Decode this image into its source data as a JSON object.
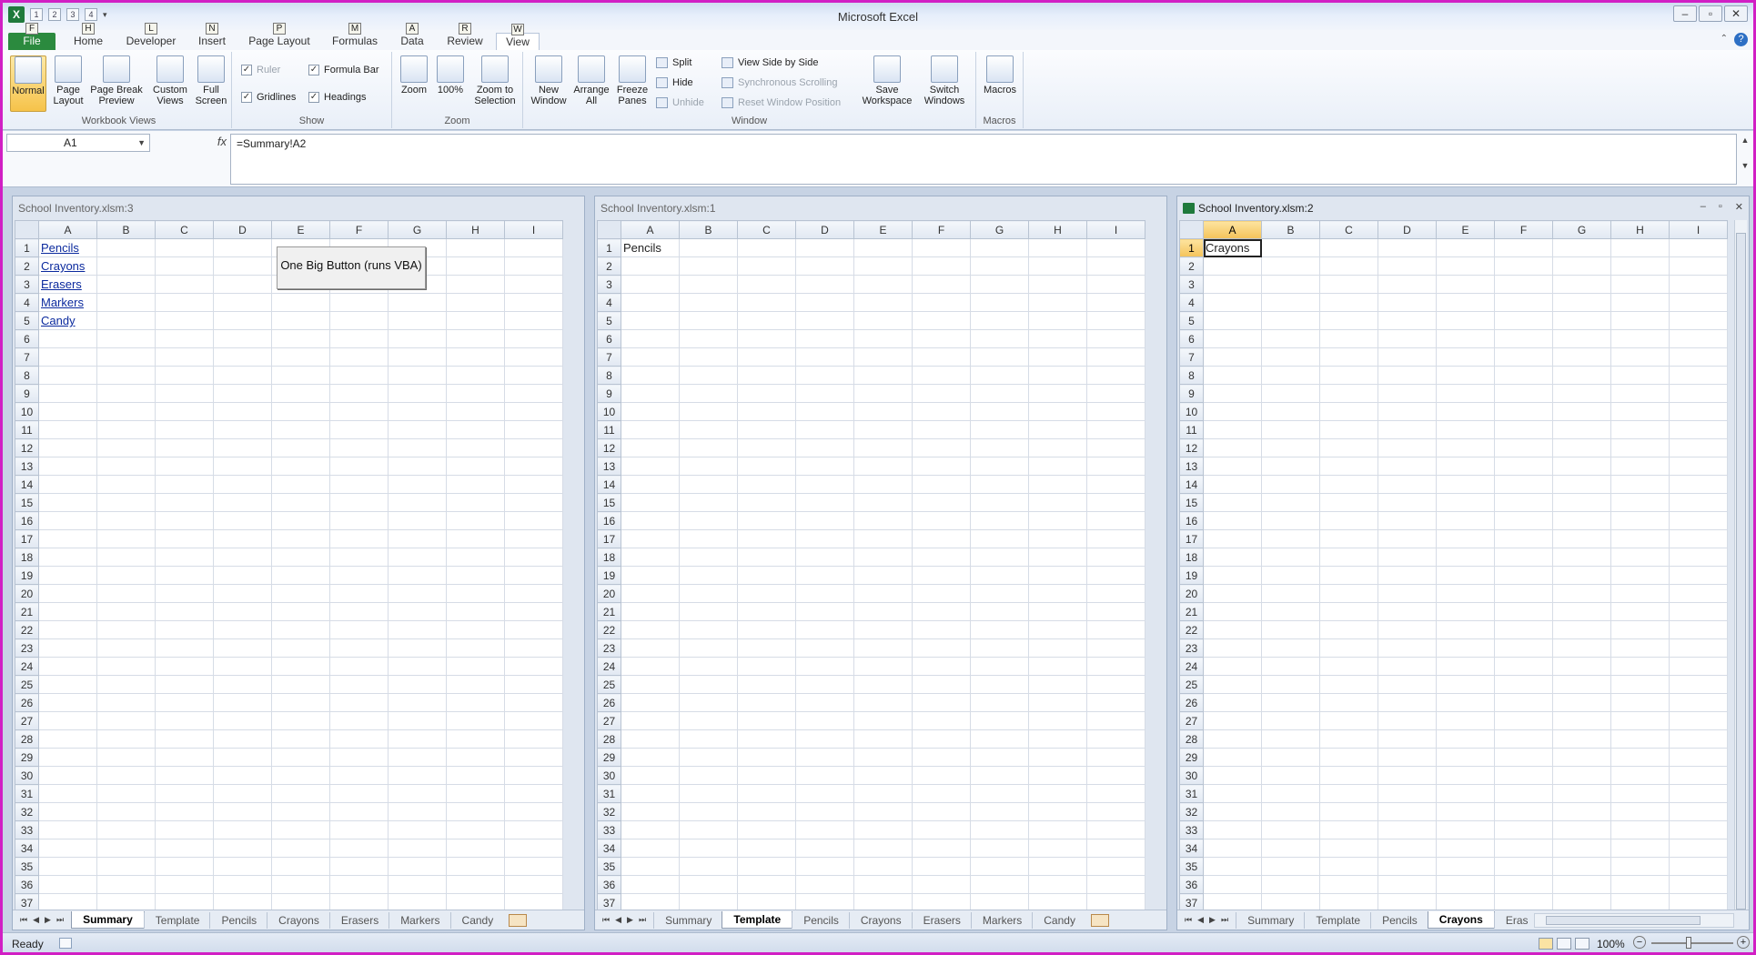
{
  "app": {
    "title": "Microsoft Excel"
  },
  "qat": [
    "1",
    "2",
    "3",
    "4"
  ],
  "tabs": [
    {
      "label": "File",
      "key": "F"
    },
    {
      "label": "Home",
      "key": "H"
    },
    {
      "label": "Developer",
      "key": "L"
    },
    {
      "label": "Insert",
      "key": "N"
    },
    {
      "label": "Page Layout",
      "key": "P"
    },
    {
      "label": "Formulas",
      "key": "M"
    },
    {
      "label": "Data",
      "key": "A"
    },
    {
      "label": "Review",
      "key": "R"
    },
    {
      "label": "View",
      "key": "W"
    }
  ],
  "ribbon": {
    "workbook_views": {
      "label": "Workbook Views",
      "normal": "Normal",
      "page_layout": "Page Layout",
      "page_break": "Page Break Preview",
      "custom": "Custom Views",
      "full": "Full Screen"
    },
    "show": {
      "label": "Show",
      "ruler": "Ruler",
      "gridlines": "Gridlines",
      "formula_bar": "Formula Bar",
      "headings": "Headings"
    },
    "zoom": {
      "label": "Zoom",
      "zoom": "Zoom",
      "pct": "100%",
      "sel": "Zoom to Selection"
    },
    "window": {
      "label": "Window",
      "new": "New Window",
      "arrange": "Arrange All",
      "freeze": "Freeze Panes",
      "split": "Split",
      "hide": "Hide",
      "unhide": "Unhide",
      "side": "View Side by Side",
      "sync": "Synchronous Scrolling",
      "reset": "Reset Window Position",
      "save": "Save Workspace",
      "switch": "Switch Windows"
    },
    "macros": {
      "label": "Macros",
      "btn": "Macros"
    }
  },
  "formula_bar": {
    "name_box": "A1",
    "formula": "=Summary!A2"
  },
  "windows": [
    {
      "title": "School Inventory.xlsm:3",
      "cells": [
        "Pencils",
        "Crayons",
        "Erasers",
        "Markers",
        "Candy"
      ],
      "button": "One Big Button (runs VBA)",
      "active_tab": "Summary"
    },
    {
      "title": "School Inventory.xlsm:1",
      "cells": [
        "Pencils"
      ],
      "active_tab": "Template"
    },
    {
      "title": "School Inventory.xlsm:2",
      "cells": [
        "Crayons"
      ],
      "active_tab": "Crayons"
    }
  ],
  "sheet_tabs": [
    "Summary",
    "Template",
    "Pencils",
    "Crayons",
    "Erasers",
    "Markers",
    "Candy"
  ],
  "sheet_tabs_w3": [
    "Summary",
    "Template",
    "Pencils",
    "Crayons",
    "Eras"
  ],
  "columns": [
    "A",
    "B",
    "C",
    "D",
    "E",
    "F",
    "G",
    "H",
    "I"
  ],
  "status": {
    "ready": "Ready",
    "zoom": "100%"
  }
}
